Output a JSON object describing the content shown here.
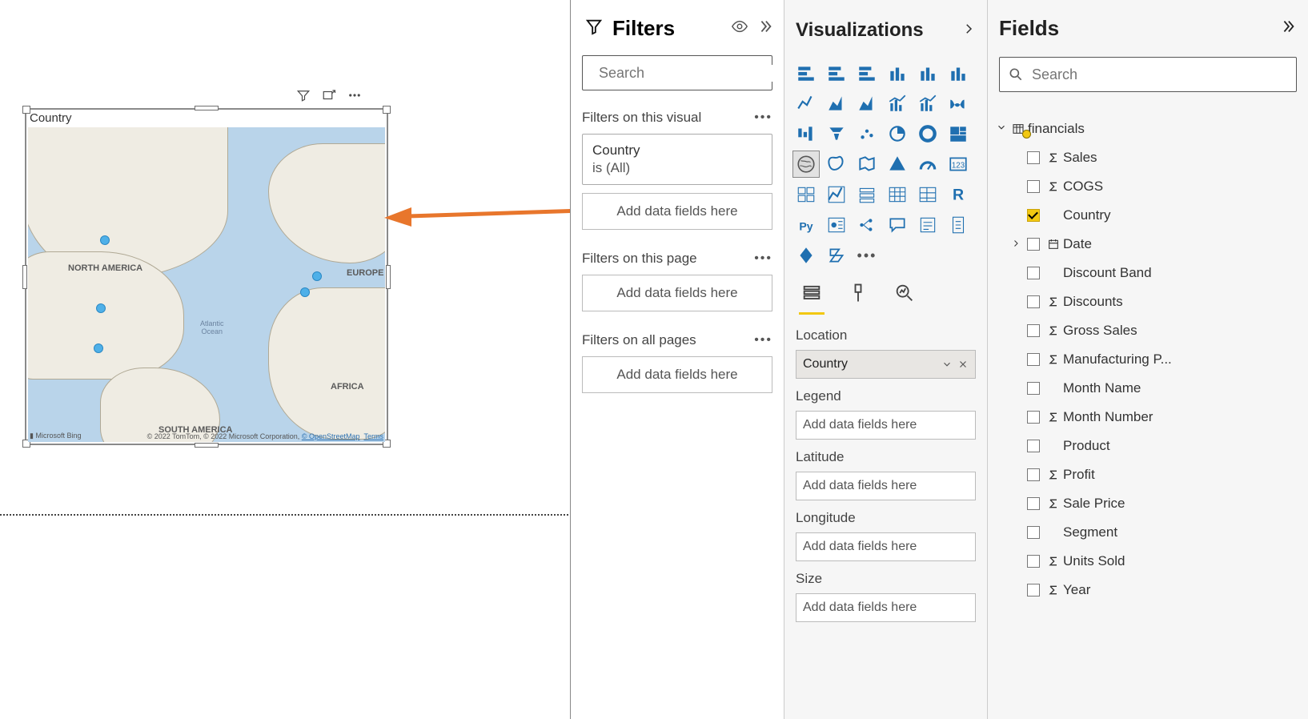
{
  "canvas": {
    "visual_title": "Country",
    "map": {
      "continents": [
        "NORTH AMERICA",
        "EUROPE",
        "AFRICA",
        "SOUTH AMERICA"
      ],
      "ocean_label1": "Atlantic",
      "ocean_label2": "Ocean",
      "attribution_left": "Microsoft Bing",
      "attribution_right_prefix": "© 2022 TomTom, © 2022 Microsoft Corporation, ",
      "attribution_link1": "© OpenStreetMap",
      "attribution_link2": "Terms"
    }
  },
  "filters": {
    "title": "Filters",
    "search_placeholder": "Search",
    "sections": {
      "visual_label": "Filters on this visual",
      "page_label": "Filters on this page",
      "all_label": "Filters on all pages"
    },
    "visual_filter": {
      "field": "Country",
      "summary": "is (All)"
    },
    "drop_label": "Add data fields here"
  },
  "viz": {
    "title": "Visualizations",
    "wells": {
      "location": {
        "label": "Location",
        "value": "Country"
      },
      "legend": {
        "label": "Legend"
      },
      "latitude": {
        "label": "Latitude"
      },
      "longitude": {
        "label": "Longitude"
      },
      "size": {
        "label": "Size"
      },
      "placeholder": "Add data fields here"
    }
  },
  "fields": {
    "title": "Fields",
    "search_placeholder": "Search",
    "table": "financials",
    "items": [
      {
        "label": "Sales",
        "agg": true,
        "checked": false,
        "kind": "sum"
      },
      {
        "label": "COGS",
        "agg": true,
        "checked": false,
        "kind": "sum"
      },
      {
        "label": "Country",
        "agg": false,
        "checked": true,
        "kind": "geo"
      },
      {
        "label": "Date",
        "agg": false,
        "checked": false,
        "kind": "date",
        "expandable": true
      },
      {
        "label": "Discount Band",
        "agg": false,
        "checked": false,
        "kind": "text"
      },
      {
        "label": "Discounts",
        "agg": true,
        "checked": false,
        "kind": "sum"
      },
      {
        "label": "Gross Sales",
        "agg": true,
        "checked": false,
        "kind": "sum"
      },
      {
        "label": "Manufacturing P...",
        "agg": true,
        "checked": false,
        "kind": "sum"
      },
      {
        "label": "Month Name",
        "agg": false,
        "checked": false,
        "kind": "text"
      },
      {
        "label": "Month Number",
        "agg": true,
        "checked": false,
        "kind": "sum"
      },
      {
        "label": "Product",
        "agg": false,
        "checked": false,
        "kind": "text"
      },
      {
        "label": "Profit",
        "agg": true,
        "checked": false,
        "kind": "sum"
      },
      {
        "label": "Sale Price",
        "agg": true,
        "checked": false,
        "kind": "sum"
      },
      {
        "label": "Segment",
        "agg": false,
        "checked": false,
        "kind": "text"
      },
      {
        "label": "Units Sold",
        "agg": true,
        "checked": false,
        "kind": "sum"
      },
      {
        "label": "Year",
        "agg": true,
        "checked": false,
        "kind": "sum"
      }
    ]
  }
}
